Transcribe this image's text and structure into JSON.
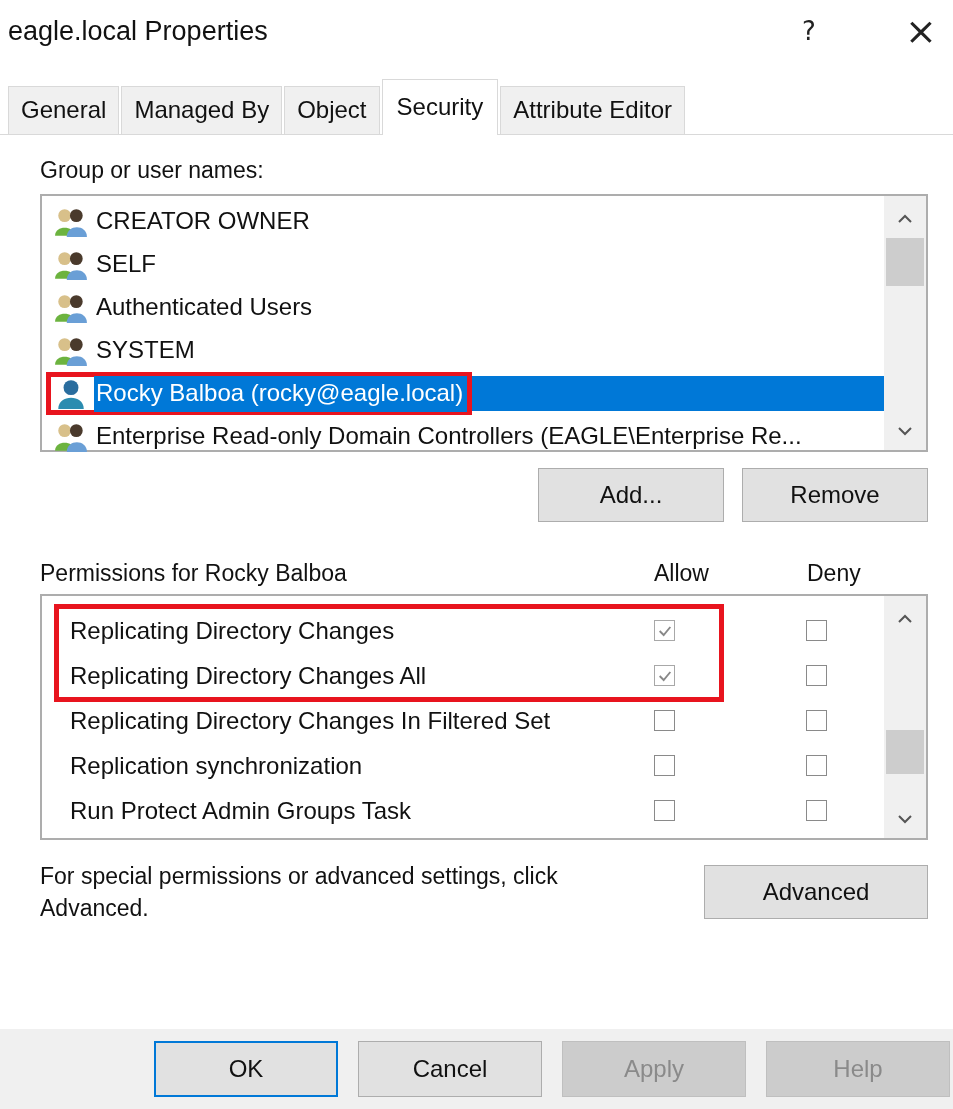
{
  "window": {
    "title": "eagle.local Properties",
    "help_glyph": "?",
    "close_glyph": "×"
  },
  "tabs": [
    {
      "label": "General",
      "selected": false
    },
    {
      "label": "Managed By",
      "selected": false
    },
    {
      "label": "Object",
      "selected": false
    },
    {
      "label": "Security",
      "selected": true
    },
    {
      "label": "Attribute Editor",
      "selected": false
    }
  ],
  "names": {
    "label": "Group or user names:",
    "items": [
      {
        "name": "CREATOR OWNER",
        "kind": "group",
        "selected": false,
        "highlighted": false
      },
      {
        "name": "SELF",
        "kind": "group",
        "selected": false,
        "highlighted": false
      },
      {
        "name": "Authenticated Users",
        "kind": "group",
        "selected": false,
        "highlighted": false
      },
      {
        "name": "SYSTEM",
        "kind": "group",
        "selected": false,
        "highlighted": false
      },
      {
        "name": "Rocky Balboa (rocky@eagle.local)",
        "kind": "user",
        "selected": true,
        "highlighted": true
      },
      {
        "name": "Enterprise Read-only Domain Controllers (EAGLE\\Enterprise Re...",
        "kind": "group",
        "selected": false,
        "highlighted": false
      }
    ],
    "buttons": [
      "Add...",
      "Remove"
    ]
  },
  "permissions": {
    "label": "Permissions for Rocky Balboa",
    "allow_header": "Allow",
    "deny_header": "Deny",
    "rows": [
      {
        "name": "Replicating Directory Changes",
        "allow": true,
        "deny": false,
        "highlighted": true
      },
      {
        "name": "Replicating Directory Changes All",
        "allow": true,
        "deny": false,
        "highlighted": true
      },
      {
        "name": "Replicating Directory Changes In Filtered Set",
        "allow": false,
        "deny": false,
        "highlighted": false
      },
      {
        "name": "Replication synchronization",
        "allow": false,
        "deny": false,
        "highlighted": false
      },
      {
        "name": "Run Protect Admin Groups Task",
        "allow": false,
        "deny": false,
        "highlighted": false
      }
    ]
  },
  "advanced": {
    "text": "For special permissions or advanced settings, click Advanced.",
    "button": "Advanced"
  },
  "footer_buttons": [
    {
      "label": "OK",
      "default": true,
      "disabled": false
    },
    {
      "label": "Cancel",
      "default": false,
      "disabled": false
    },
    {
      "label": "Apply",
      "default": false,
      "disabled": true
    },
    {
      "label": "Help",
      "default": false,
      "disabled": true
    }
  ]
}
